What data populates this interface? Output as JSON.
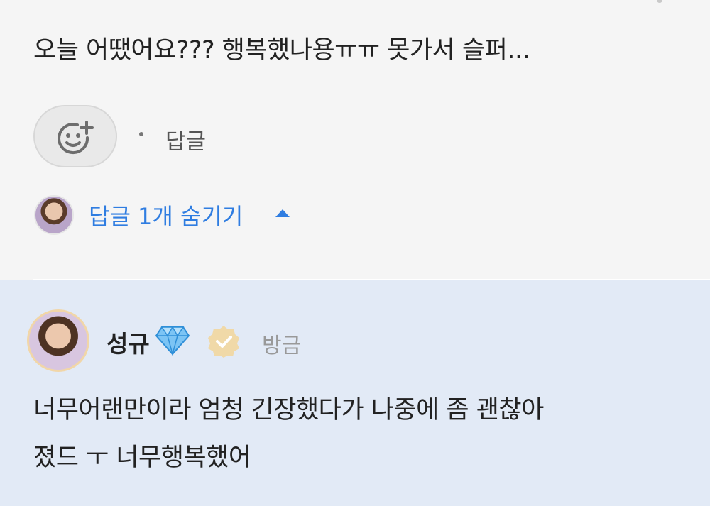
{
  "comment": {
    "text": "오늘 어땠어요??? 행복했나용ㅠㅠ 못가서 슬퍼...",
    "reply_label": "답글",
    "hide_replies_label": "답글 1개 숨기기",
    "emoji_icon": "add-reaction-icon",
    "caret_icon": "caret-up-icon"
  },
  "reply": {
    "username": "성규",
    "time": "방금",
    "text": "너무어랜만이라 엄청 긴장했다가 나중에 좀 괜찮아\n졌드 ㅜ 너무행복했어",
    "gem_icon": "diamond-icon",
    "badge_icon": "verified-badge-icon"
  },
  "colors": {
    "link": "#2f7de1",
    "reply_bg": "#e2eaf6",
    "badge": "#f0d9a8"
  }
}
